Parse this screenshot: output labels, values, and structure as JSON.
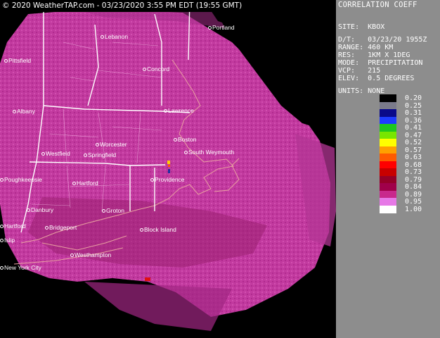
{
  "timestamp": "© 2020 WeatherTAP.com - 03/23/2020  3:55 PM EDT (19:55 GMT)",
  "panel": {
    "title": "CORRELATION COEFF",
    "site_label": "SITE:",
    "site": "KBOX",
    "dt_label": "D/T:",
    "dt": "03/23/20 1955Z",
    "range_label": "RANGE:",
    "range": "460 KM",
    "res_label": "RES:",
    "res": "1KM X 1DEG",
    "mode_label": "MODE:",
    "mode": "PRECIPITATION",
    "vcp_label": "VCP:",
    "vcp": "215",
    "elev_label": "ELEV:",
    "elev": "0.5 DEGREES",
    "units_label": "UNITS:",
    "units": "NONE"
  },
  "legend": [
    {
      "value": "0.20",
      "color": "#000000"
    },
    {
      "value": "0.25",
      "color": "#7a7a8a"
    },
    {
      "value": "0.31",
      "color": "#0a0a8a"
    },
    {
      "value": "0.36",
      "color": "#1e3cff"
    },
    {
      "value": "0.41",
      "color": "#1ec81e"
    },
    {
      "value": "0.47",
      "color": "#78e600"
    },
    {
      "value": "0.52",
      "color": "#ffff00"
    },
    {
      "value": "0.57",
      "color": "#ffa000"
    },
    {
      "value": "0.63",
      "color": "#ff5a00"
    },
    {
      "value": "0.68",
      "color": "#ff0000"
    },
    {
      "value": "0.73",
      "color": "#c80000"
    },
    {
      "value": "0.79",
      "color": "#960028"
    },
    {
      "value": "0.84",
      "color": "#a0004a"
    },
    {
      "value": "0.89",
      "color": "#c8288c"
    },
    {
      "value": "0.95",
      "color": "#e678e6"
    },
    {
      "value": "1.00",
      "color": "#ffffff"
    }
  ],
  "cities": [
    {
      "name": "Lebanon"
    },
    {
      "name": "Portland"
    },
    {
      "name": "Pittsfield"
    },
    {
      "name": "Concord"
    },
    {
      "name": "Albany"
    },
    {
      "name": "Lawrence"
    },
    {
      "name": "Worcester"
    },
    {
      "name": "Boston"
    },
    {
      "name": "Westfield"
    },
    {
      "name": "Springfield"
    },
    {
      "name": "South Weymouth"
    },
    {
      "name": "Poughkeepsie"
    },
    {
      "name": "Hartford"
    },
    {
      "name": "Providence"
    },
    {
      "name": "Danbury"
    },
    {
      "name": "Groton"
    },
    {
      "name": "Hartford"
    },
    {
      "name": "Bridgeport"
    },
    {
      "name": "Block Island"
    },
    {
      "name": "Westhampton"
    },
    {
      "name": "New York City"
    },
    {
      "name": "Islip"
    }
  ]
}
